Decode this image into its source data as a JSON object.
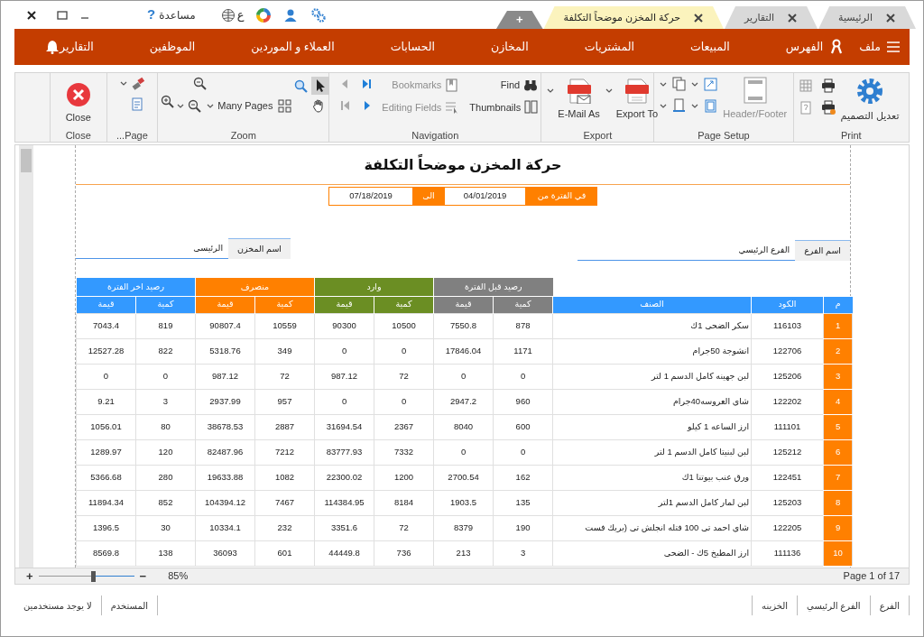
{
  "window": {
    "help_icon": "?",
    "help": "مساعدة",
    "language": "ع",
    "new_tab": "+"
  },
  "tabs": [
    {
      "label": "الرئيسية",
      "selected": false
    },
    {
      "label": "التقارير",
      "selected": false
    },
    {
      "label": "حركة المخزن موضحاً التكلفة",
      "selected": true
    }
  ],
  "menu": {
    "file": "ملف",
    "index": "الفهرس",
    "items": [
      "المبيعات",
      "المشتريات",
      "المخازن",
      "الحسابات",
      "العملاء و الموردين",
      "الموظفين",
      "التقارير"
    ]
  },
  "ribbon": {
    "groups": [
      {
        "label": "Print",
        "buttons": [
          {
            "label": "تعديل التصميم",
            "disabled": false
          }
        ]
      },
      {
        "label": "Page Setup",
        "buttons": [
          {
            "label": "Header/Footer",
            "disabled": true
          }
        ]
      },
      {
        "label": "Export",
        "buttons": [
          {
            "label": "Export To",
            "disabled": false
          },
          {
            "label": "E-Mail As",
            "disabled": false
          }
        ]
      },
      {
        "label": "Navigation",
        "buttons": [
          {
            "label": "Find",
            "disabled": false
          },
          {
            "label": "Bookmarks",
            "disabled": true
          },
          {
            "label": "Thumbnails",
            "disabled": false
          },
          {
            "label": "Editing Fields",
            "disabled": true
          }
        ]
      },
      {
        "label": "Zoom",
        "buttons": [
          {
            "label": "Many Pages",
            "disabled": false
          }
        ],
        "tools": [
          {
            "kind": "pointer",
            "selected": true
          },
          {
            "kind": "hand",
            "selected": false
          }
        ]
      },
      {
        "label": "...Page"
      },
      {
        "label": "Close",
        "buttons": [
          {
            "label": "Close",
            "disabled": false
          }
        ]
      }
    ]
  },
  "report": {
    "title": "حركة المخزن موضحاً التكلفة",
    "period_label": "في الفترة من",
    "from": "04/01/2019",
    "to_label": "الى",
    "to": "07/18/2019",
    "branch_label": "اسم الفرع",
    "branch": "الفرع الرئيسي",
    "store_label": "اسم المخزن",
    "store": "الرئيسى",
    "columns": [
      "م",
      "الكود",
      "الصنف"
    ],
    "column_groups": [
      {
        "label": "رصيد قبل الفترة",
        "color": "#808080",
        "subcolumns": [
          "كمية",
          "قيمة"
        ]
      },
      {
        "label": "وارد",
        "color": "#6b8e23",
        "subcolumns": [
          "كمية",
          "قيمة"
        ]
      },
      {
        "label": "منصرف",
        "color": "#ff8000",
        "subcolumns": [
          "كمية",
          "قيمة"
        ]
      },
      {
        "label": "رصيد اخر الفترة",
        "color": "#3399ff",
        "subcolumns": [
          "كمية",
          "قيمة"
        ]
      }
    ],
    "rows": [
      {
        "no": "1",
        "code": "116103",
        "item": "سكر الضحى 1ك",
        "values": [
          "878",
          "7550.8",
          "10500",
          "90300",
          "10559",
          "90807.4",
          "819",
          "7043.4"
        ]
      },
      {
        "no": "2",
        "code": "122706",
        "item": "انشوجة 50جرام",
        "values": [
          "1171",
          "17846.04",
          "0",
          "0",
          "349",
          "5318.76",
          "822",
          "12527.28"
        ]
      },
      {
        "no": "3",
        "code": "125206",
        "item": "لبن جهينه كامل الدسم 1 لتر",
        "values": [
          "0",
          "0",
          "72",
          "987.12",
          "72",
          "987.12",
          "0",
          "0"
        ]
      },
      {
        "no": "4",
        "code": "122202",
        "item": "شاى العروسه40جرام",
        "values": [
          "960",
          "2947.2",
          "0",
          "0",
          "957",
          "2937.99",
          "3",
          "9.21"
        ]
      },
      {
        "no": "5",
        "code": "111101",
        "item": "ارز الساعه 1 كيلو",
        "values": [
          "600",
          "8040",
          "2367",
          "31694.54",
          "2887",
          "38678.53",
          "80",
          "1056.01"
        ]
      },
      {
        "no": "6",
        "code": "125212",
        "item": "لبن لبنيتا كامل الدسم 1 لتر",
        "values": [
          "0",
          "0",
          "7332",
          "83777.93",
          "7212",
          "82487.96",
          "120",
          "1289.97"
        ]
      },
      {
        "no": "7",
        "code": "122451",
        "item": "ورق عنب بيوتنا 1ك",
        "values": [
          "162",
          "2700.54",
          "1200",
          "22300.02",
          "1082",
          "19633.88",
          "280",
          "5366.68"
        ]
      },
      {
        "no": "8",
        "code": "125203",
        "item": "لبن لمار كامل الدسم 1لتر",
        "values": [
          "135",
          "1903.5",
          "8184",
          "114384.95",
          "7467",
          "104394.12",
          "852",
          "11894.34"
        ]
      },
      {
        "no": "9",
        "code": "122205",
        "item": "شاى احمد تى 100 فتله انجلش تى (بريك فست",
        "values": [
          "190",
          "8379",
          "72",
          "3351.6",
          "232",
          "10334.1",
          "30",
          "1396.5"
        ]
      },
      {
        "no": "10",
        "code": "111136",
        "item": "ارز المطبخ 5ك - الضحى",
        "values": [
          "3",
          "213",
          "736",
          "44449.8",
          "601",
          "36093",
          "138",
          "8569.8"
        ]
      }
    ]
  },
  "zoom": {
    "plus": "+",
    "minus": "−",
    "level": 0.57,
    "reading": "85%",
    "page_info": "Page 1 of 17"
  },
  "status_bar": {
    "branch_label": "الفرع",
    "branch": "الفرع الرئيسي",
    "treasury_label": "الخزينه",
    "user_label": "المستخدم",
    "user": "لا يوجد مستخدمين"
  }
}
